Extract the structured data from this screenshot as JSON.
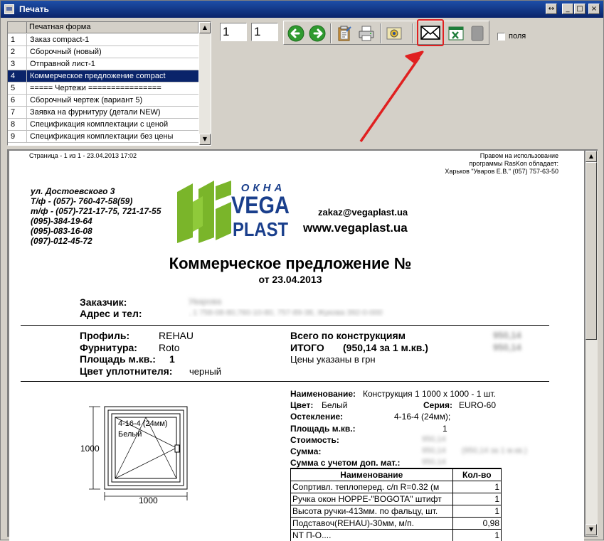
{
  "window": {
    "title": "Печать"
  },
  "list": {
    "header": "Печатная форма",
    "rows": [
      {
        "n": "1",
        "t": "Заказ compact-1"
      },
      {
        "n": "2",
        "t": "Сборочный (новый)"
      },
      {
        "n": "3",
        "t": "Отправной лист-1"
      },
      {
        "n": "4",
        "t": "Коммерческое предложение compact"
      },
      {
        "n": "5",
        "t": "===== Чертежи ================"
      },
      {
        "n": "6",
        "t": "Сборочный чертеж (вариант 5)"
      },
      {
        "n": "7",
        "t": "Заявка на фурнитуру (детали NEW)"
      },
      {
        "n": "8",
        "t": "Спецификация комплектации с  ценой"
      },
      {
        "n": "9",
        "t": "Спецификация комплектации без цены"
      }
    ],
    "selected_index": 3
  },
  "toolbar": {
    "page_from": "1",
    "page_to": "1",
    "fields_label": "поля"
  },
  "document": {
    "header_left": "Страница  - 1 из 1 -   23.04.2013 17:02",
    "rights_line1": "Правом на использование",
    "rights_line2": "программы RasKon обладает:",
    "rights_line3": "Харьков   \"Уваров Е.В.\"   (057) 757-63-50",
    "contacts": [
      "ул. Достоевского  3",
      "Т/ф - (057)- 760-47-58(59)",
      "т/ф - (057)-721-17-75, 721-17-55",
      "(095)-384-19-64",
      "(095)-083-16-08",
      "(097)-012-45-72"
    ],
    "logo_top": "ОКНА",
    "logo_mid": "VEGA",
    "logo_bottom": "PLAST",
    "email": "zakaz@vegaplast.ua",
    "website": "www.vegaplast.ua",
    "title": "Коммерческое предложение №",
    "date_line": "от 23.04.2013",
    "customer_label": "Заказчик:",
    "customer_value": "Уварова",
    "address_label": "Адрес и тел:",
    "address_value": ", 1 758-08-80,760-10-80, 757-89-38, Жукова 392-0-000",
    "profile_label": "Профиль:",
    "profile_value": "REHAU",
    "hardware_label": "Фурнитура:",
    "hardware_value": "Roto",
    "area_label": "Площадь м.кв.:",
    "area_value": "1",
    "seal_label": "Цвет уплотнителя:",
    "seal_value": "черный",
    "total_constructions_label": "Всего по конструкциям",
    "total_constructions_value": "950,14",
    "total_label": "ИТОГО",
    "total_per_m2": "(950,14 за 1 м.кв.)",
    "total_value": "950,14",
    "currency_note": "Цены указаны в  грн",
    "drawing": {
      "size_v": "1000",
      "size_h": "1000",
      "glass_text": "4-16-4 (24мм)",
      "color_text": "Белый"
    },
    "details": {
      "name_label": "Наименование:",
      "name_value": "Конструкция 1 1000 x 1000 - 1 шт.",
      "color_label": "Цвет:",
      "color_value": "Белый",
      "series_label": "Серия:",
      "series_value": "EURO-60",
      "glazing_label": "Остекление:",
      "glazing_value": "4-16-4 (24мм);",
      "area_label": "Площадь м.кв.:",
      "area_value": "1",
      "cost_label": "Стоимость:",
      "cost_value": "950,14",
      "sum_label": "Сумма:",
      "sum_value": "950,14",
      "sum_note": "(950,14 за 1 м.кв.)",
      "sum_extra_label": "Сумма с учетом доп. мат.:",
      "sum_extra_value": "950,14"
    },
    "table": {
      "headers": [
        "Наименование",
        "Кол-во"
      ],
      "rows": [
        {
          "name": "Сопртивл. теплоперед. с/п  R=0.32 (м",
          "qty": "1"
        },
        {
          "name": "Ручка окон HOPPE-\"BOGOTA\" штифт",
          "qty": "1"
        },
        {
          "name": "Высота ручки-413мм. по фальцу, шт.",
          "qty": "1"
        },
        {
          "name": "Подставоч(REHAU)-30мм, м/п.",
          "qty": "0,98"
        },
        {
          "name": "NT П-О....",
          "qty": "1"
        }
      ]
    }
  },
  "colors": {
    "title_bg": "#0a246a",
    "logo_green": "#7ab52a",
    "logo_blue": "#1a3f8c",
    "highlight": "#e02020"
  }
}
